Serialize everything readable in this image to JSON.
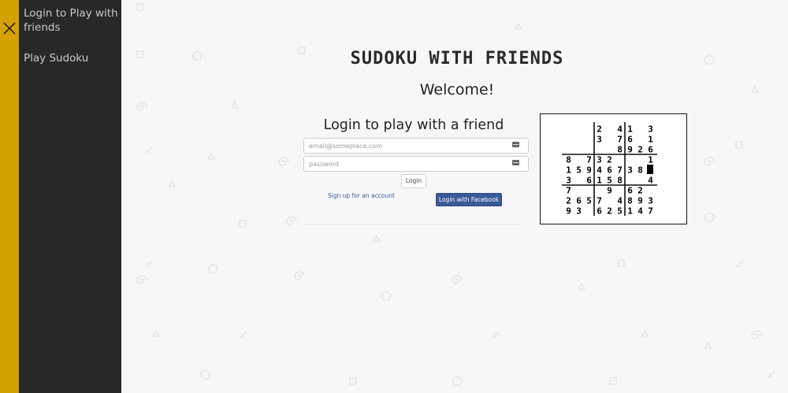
{
  "sidebar": {
    "items": [
      {
        "label": "Login to Play with friends"
      },
      {
        "label": "Play Sudoku"
      }
    ]
  },
  "header": {
    "title": "SUDOKU WITH FRIENDS",
    "welcome": "Welcome!"
  },
  "login": {
    "heading": "Login to play with a friend",
    "email_placeholder": "email@someplace.com",
    "password_placeholder": "password",
    "login_label": "Login",
    "signup_label": "Sign up for an account",
    "facebook_label": "Login with Facebook"
  },
  "board": {
    "rows": [
      [
        "",
        "",
        "",
        "2",
        "",
        "4",
        "1",
        "",
        "3"
      ],
      [
        "",
        "",
        "",
        "3",
        "",
        "7",
        "6",
        "",
        "1"
      ],
      [
        "",
        "",
        "",
        "",
        "",
        "8",
        "9",
        "2",
        "6"
      ],
      [
        "8",
        "",
        "7",
        "3",
        "2",
        "",
        "",
        "",
        "1"
      ],
      [
        "1",
        "5",
        "9",
        "4",
        "6",
        "7",
        "3",
        "8",
        ""
      ],
      [
        "3",
        "",
        "6",
        "1",
        "5",
        "8",
        "",
        "",
        "4"
      ],
      [
        "7",
        "",
        "",
        "",
        "9",
        "",
        "6",
        "2",
        ""
      ],
      [
        "2",
        "6",
        "5",
        "7",
        "",
        "4",
        "8",
        "9",
        "3"
      ],
      [
        "9",
        "3",
        "",
        "6",
        "2",
        "5",
        "1",
        "4",
        "7"
      ]
    ],
    "selected_cell": [
      4,
      8
    ]
  },
  "colors": {
    "accent": "#d4a100",
    "sidebar_bg": "#282828",
    "page_bg": "#f7f7f9",
    "facebook": "#3b5998"
  },
  "icons": {
    "close": "close-icon",
    "field": "keyboard-icon"
  }
}
